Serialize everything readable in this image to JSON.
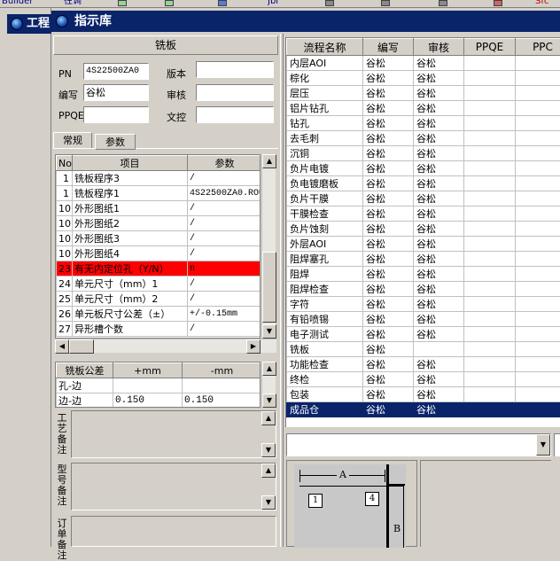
{
  "topbar": {
    "items": [
      "Builder",
      "往调",
      "Jbl",
      "Sfc"
    ]
  },
  "background_window": {
    "title": "工程"
  },
  "window": {
    "title": "指示库"
  },
  "left_panel": {
    "header": "铣板",
    "fields": {
      "pn_label": "PN",
      "pn_value": "4S22500ZA0",
      "version_label": "版本",
      "version_value": "",
      "author_label": "编写",
      "author_value": "谷松",
      "review_label": "审核",
      "review_value": "",
      "ppqe_label": "PPQE",
      "ppqe_value": "",
      "doc_control_label": "文控",
      "doc_control_value": ""
    },
    "tabs": [
      "常规",
      "参数"
    ],
    "param_table": {
      "headers": [
        "No",
        "项目",
        "参数"
      ],
      "rows": [
        {
          "no": "1",
          "item": "铣板程序3",
          "value": "/"
        },
        {
          "no": "1",
          "item": "铣板程序1",
          "value": "4S22500ZA0.ROU"
        },
        {
          "no": "10",
          "item": "外形图纸1",
          "value": "/"
        },
        {
          "no": "10",
          "item": "外形图纸2",
          "value": "/"
        },
        {
          "no": "10",
          "item": "外形图纸3",
          "value": "/"
        },
        {
          "no": "10",
          "item": "外形图纸4",
          "value": "/"
        },
        {
          "no": "23",
          "item": "有无内定位孔（Y/N）",
          "value": "n"
        },
        {
          "no": "24",
          "item": "单元尺寸（mm）1",
          "value": "/"
        },
        {
          "no": "25",
          "item": "单元尺寸（mm）2",
          "value": "/"
        },
        {
          "no": "26",
          "item": "单元板尺寸公差（±）",
          "value": "+/-0.15mm"
        },
        {
          "no": "27",
          "item": "异形槽个数",
          "value": "/"
        }
      ],
      "highlight_row": 6,
      "highlight_color": "#ff0000"
    },
    "tolerance_table": {
      "headers": [
        "铣板公差",
        "+mm",
        "-mm"
      ],
      "rows": [
        {
          "name": "孔-边",
          "plus": "",
          "minus": ""
        },
        {
          "name": "边-边",
          "plus": "0.150",
          "minus": "0.150"
        }
      ]
    },
    "notes": {
      "process_note_label": "工艺备注",
      "model_note_label": "型号备注",
      "order_note_label": "订单备注"
    }
  },
  "process_grid": {
    "headers": [
      "流程名称",
      "编写",
      "审核",
      "PPQE",
      "PPC"
    ],
    "rows": [
      [
        "内层AOI",
        "谷松",
        "谷松",
        "",
        ""
      ],
      [
        "棕化",
        "谷松",
        "谷松",
        "",
        ""
      ],
      [
        "层压",
        "谷松",
        "谷松",
        "",
        ""
      ],
      [
        "铝片钻孔",
        "谷松",
        "谷松",
        "",
        ""
      ],
      [
        "钻孔",
        "谷松",
        "谷松",
        "",
        ""
      ],
      [
        "去毛刺",
        "谷松",
        "谷松",
        "",
        ""
      ],
      [
        "沉铜",
        "谷松",
        "谷松",
        "",
        ""
      ],
      [
        "负片电镀",
        "谷松",
        "谷松",
        "",
        ""
      ],
      [
        "负电镀磨板",
        "谷松",
        "谷松",
        "",
        ""
      ],
      [
        "负片干膜",
        "谷松",
        "谷松",
        "",
        ""
      ],
      [
        "干膜检查",
        "谷松",
        "谷松",
        "",
        ""
      ],
      [
        "负片蚀刻",
        "谷松",
        "谷松",
        "",
        ""
      ],
      [
        "外层AOI",
        "谷松",
        "谷松",
        "",
        ""
      ],
      [
        "阻焊塞孔",
        "谷松",
        "谷松",
        "",
        ""
      ],
      [
        "阻焊",
        "谷松",
        "谷松",
        "",
        ""
      ],
      [
        "阻焊检查",
        "谷松",
        "谷松",
        "",
        ""
      ],
      [
        "字符",
        "谷松",
        "谷松",
        "",
        ""
      ],
      [
        "有铅喷锡",
        "谷松",
        "谷松",
        "",
        ""
      ],
      [
        "电子测试",
        "谷松",
        "谷松",
        "",
        ""
      ],
      [
        "铣板",
        "谷松",
        "",
        "",
        ""
      ],
      [
        "功能检查",
        "谷松",
        "谷松",
        "",
        ""
      ],
      [
        "终检",
        "谷松",
        "谷松",
        "",
        ""
      ],
      [
        "包装",
        "谷松",
        "谷松",
        "",
        ""
      ],
      [
        "成品仓",
        "谷松",
        "谷松",
        "",
        ""
      ]
    ],
    "selected_row": 23,
    "selection_color": "#0a246a"
  },
  "diagram": {
    "label_a": "A",
    "label_b": "B",
    "marker_1": "1",
    "marker_4": "4"
  }
}
